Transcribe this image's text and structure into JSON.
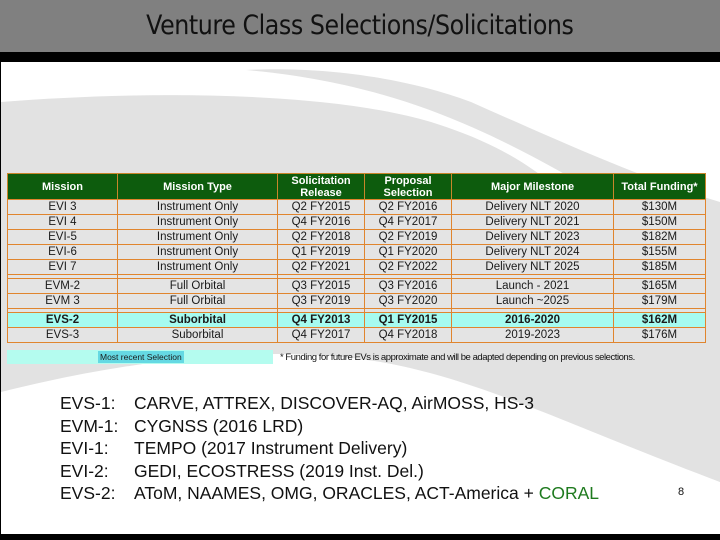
{
  "title": "Venture Class Selections/Solicitations",
  "colors": {
    "header_green": "#0d5c0d",
    "border_orange": "#e0852e",
    "highlight_cyan": "#a6fbf0",
    "coral_green": "#1e7a1e",
    "title_bar_gray": "#808080"
  },
  "table": {
    "headers": [
      "Mission",
      "Mission Type",
      "Solicitation Release",
      "Proposal Selection",
      "Major Milestone",
      "Total Funding*"
    ],
    "groups": [
      {
        "rows": [
          {
            "mission": "EVI 3",
            "type": "Instrument Only",
            "release": "Q2 FY2015",
            "selection": "Q2 FY2016",
            "milestone": "Delivery NLT 2020",
            "funding": "$130M"
          },
          {
            "mission": "EVI 4",
            "type": "Instrument Only",
            "release": "Q4 FY2016",
            "selection": "Q4 FY2017",
            "milestone": "Delivery NLT 2021",
            "funding": "$150M"
          },
          {
            "mission": "EVI-5",
            "type": "Instrument Only",
            "release": "Q2 FY2018",
            "selection": "Q2 FY2019",
            "milestone": "Delivery NLT 2023",
            "funding": "$182M"
          },
          {
            "mission": "EVI-6",
            "type": "Instrument Only",
            "release": "Q1 FY2019",
            "selection": "Q1 FY2020",
            "milestone": "Delivery NLT 2024",
            "funding": "$155M"
          },
          {
            "mission": "EVI 7",
            "type": "Instrument Only",
            "release": "Q2 FY2021",
            "selection": "Q2 FY2022",
            "milestone": "Delivery NLT 2025",
            "funding": "$185M"
          }
        ]
      },
      {
        "rows": [
          {
            "mission": "EVM-2",
            "type": "Full Orbital",
            "release": "Q3 FY2015",
            "selection": "Q3 FY2016",
            "milestone": "Launch - 2021",
            "funding": "$165M"
          },
          {
            "mission": "EVM 3",
            "type": "Full Orbital",
            "release": "Q3 FY2019",
            "selection": "Q3 FY2020",
            "milestone": "Launch ~2025",
            "funding": "$179M"
          }
        ]
      },
      {
        "rows": [
          {
            "mission": "EVS-2",
            "type": "Suborbital",
            "release": "Q4 FY2013",
            "selection": "Q1 FY2015",
            "milestone": "2016-2020",
            "funding": "$162M",
            "highlight": true
          },
          {
            "mission": "EVS-3",
            "type": "Suborbital",
            "release": "Q4 FY2017",
            "selection": "Q4 FY2018",
            "milestone": "2019-2023",
            "funding": "$176M"
          }
        ]
      }
    ]
  },
  "legend": {
    "label": "Most recent Selection"
  },
  "footnote": "* Funding for future EVs is approximate and will be adapted depending on previous selections.",
  "list": [
    {
      "label": "EVS-1:",
      "text": "CARVE, ATTREX, DISCOVER-AQ, AirMOSS, HS-3"
    },
    {
      "label": "EVM-1:",
      "text": "CYGNSS (2016 LRD)"
    },
    {
      "label": "EVI-1:",
      "text": "TEMPO (2017 Instrument Delivery)"
    },
    {
      "label": "EVI-2:",
      "text": "GEDI, ECOSTRESS (2019 Inst. Del.)"
    },
    {
      "label": "EVS-2:",
      "text": "AToM, NAAMES, OMG, ORACLES, ACT-America + ",
      "extra": "CORAL"
    }
  ],
  "page_number": "8"
}
